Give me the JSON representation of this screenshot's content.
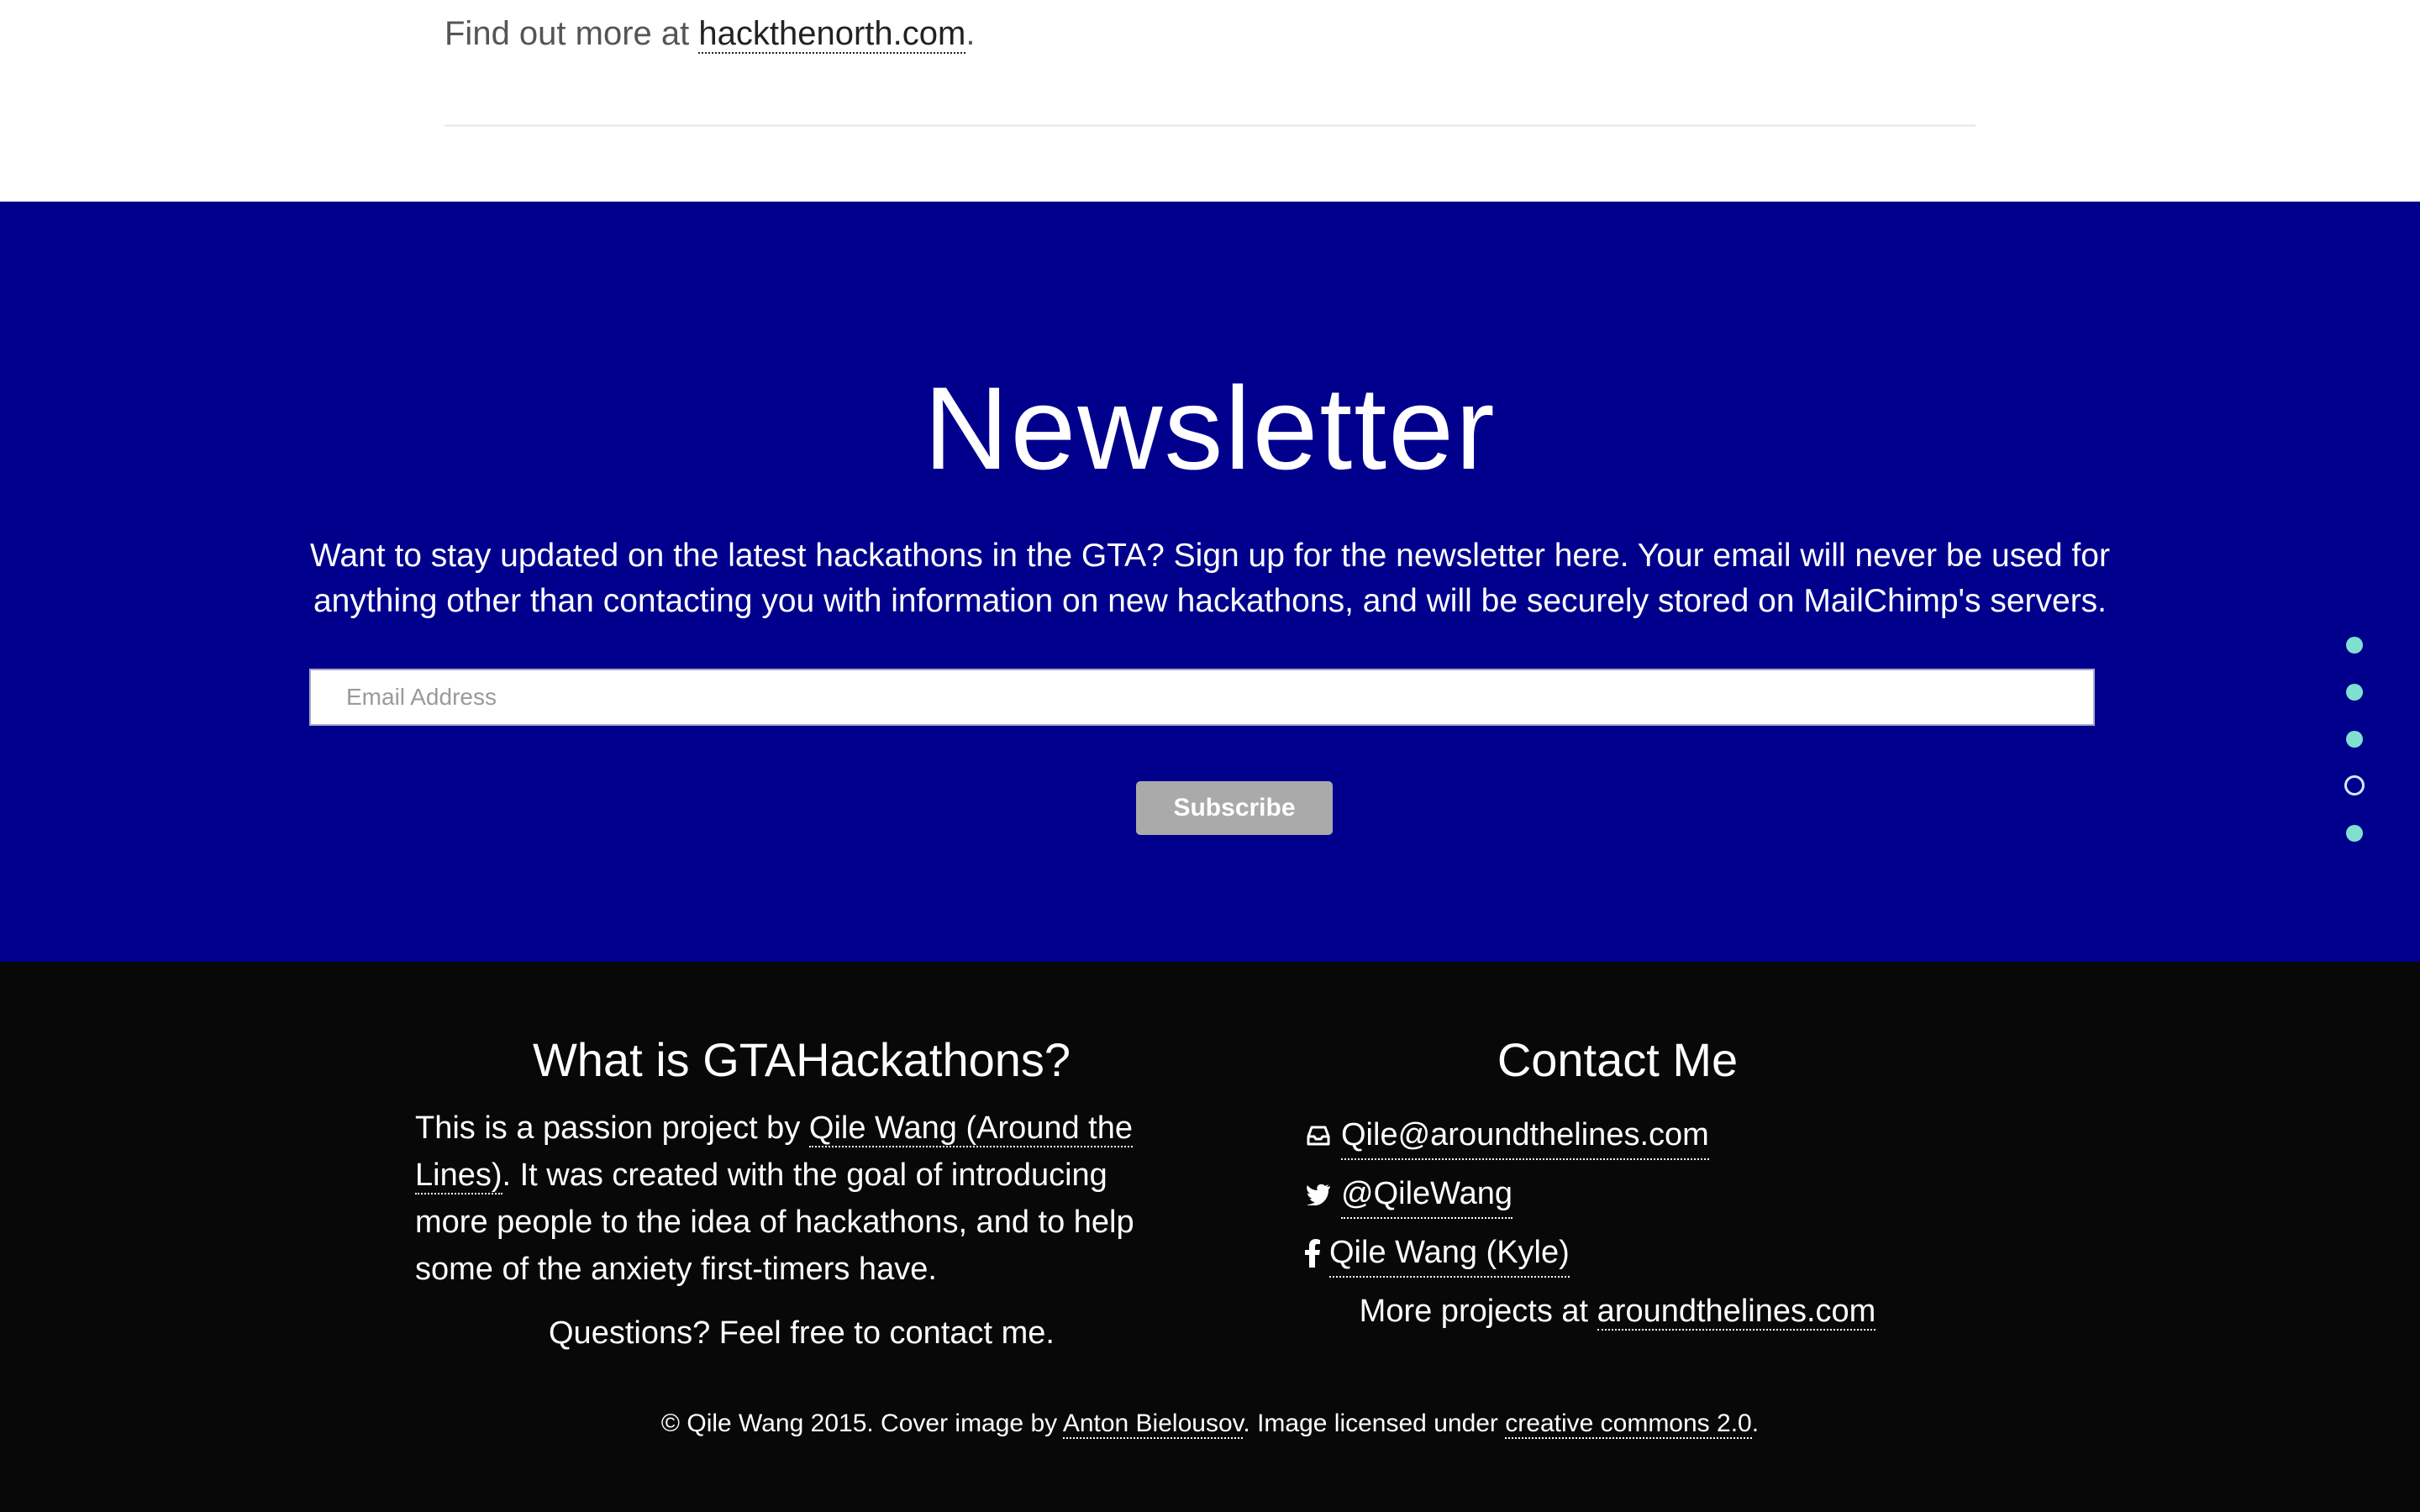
{
  "top": {
    "find_prefix": "Find out more at ",
    "find_link": "hackthenorth.com",
    "find_suffix": "."
  },
  "newsletter": {
    "title": "Newsletter",
    "description": "Want to stay updated on the latest hackathons in the GTA? Sign up for the newsletter here. Your email will never be used for anything other than contacting you with information on new hackathons, and will be securely stored on MailChimp's servers.",
    "email_placeholder": "Email Address",
    "email_value": "",
    "subscribe_label": "Subscribe",
    "bg_color": "#00008d"
  },
  "dots_nav": {
    "items": [
      {
        "state": "filled"
      },
      {
        "state": "filled"
      },
      {
        "state": "filled"
      },
      {
        "state": "active-hollow"
      },
      {
        "state": "filled"
      }
    ],
    "color": "#7fe0d0"
  },
  "footer": {
    "about": {
      "heading": "What is GTAHackathons?",
      "intro_prefix": "This is a passion project by ",
      "intro_link": "Qile Wang (Around the Lines)",
      "intro_suffix": ". It was created with the goal of introducing more people to the idea of hackathons, and to help some of the anxiety first-timers have.",
      "questions": "Questions? Feel free to contact me."
    },
    "contact": {
      "heading": "Contact Me",
      "email": "Qile@aroundthelines.com",
      "twitter": "@QileWang",
      "facebook": "Qile Wang (Kyle)",
      "more_prefix": "More projects at ",
      "more_link": "aroundthelines.com"
    },
    "copyright": {
      "prefix": "© Qile Wang 2015. Cover image by ",
      "author_link": "Anton Bielousov",
      "middle": ". Image licensed under ",
      "license_link": "creative commons 2.0",
      "suffix": "."
    }
  }
}
